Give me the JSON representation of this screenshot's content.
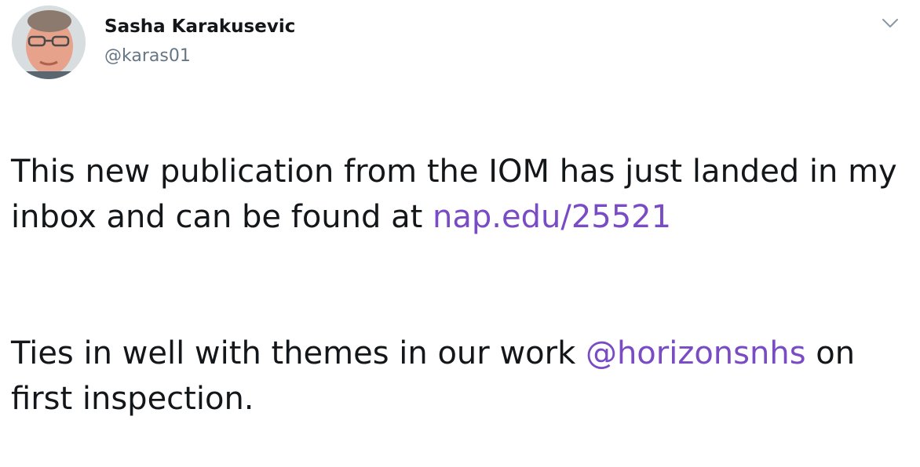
{
  "author": {
    "name": "Sasha Karakusevic",
    "handle": "@karas01"
  },
  "tweet": {
    "para1_text": "This new publication from the IOM has just landed in my inbox and can be found at ",
    "para1_link": "nap.edu/25521",
    "para2_text_before": "Ties in well with themes in our work ",
    "para2_mention": "@horizonsnhs",
    "para2_text_after": " on first inspection."
  },
  "colors": {
    "link": "#794bc4",
    "text": "#14171a",
    "secondary": "#657786"
  },
  "icons": {
    "menu": "chevron-down-icon"
  }
}
